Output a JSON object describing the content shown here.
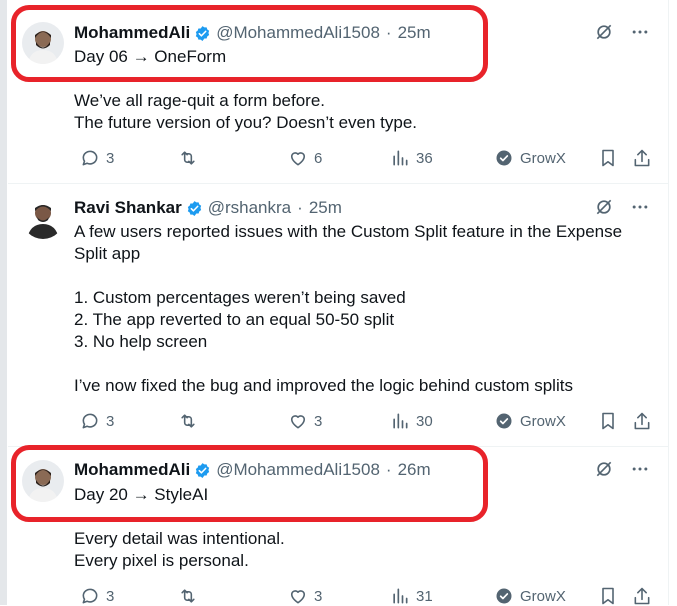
{
  "tweets": [
    {
      "author_name": "MohammedAli",
      "handle": "@MohammedAli1508",
      "time": "25m",
      "title_line": "Day 06 → OneForm",
      "body": "We’ve all rage-quit a form before.\nThe future version of you? Doesn’t even type.",
      "replies": "3",
      "retweets": "",
      "likes": "6",
      "views": "36",
      "growx": "GrowX"
    },
    {
      "author_name": "Ravi Shankar",
      "handle": "@rshankra",
      "time": "25m",
      "body": "A few users reported issues with the Custom Split feature in the Expense\nSplit app\n\n1. Custom percentages weren’t being saved\n2. The app reverted to an equal 50-50 split\n3. No help screen\n\nI’ve now fixed the bug and improved the logic behind custom splits",
      "replies": "3",
      "retweets": "",
      "likes": "3",
      "views": "30",
      "growx": "GrowX"
    },
    {
      "author_name": "MohammedAli",
      "handle": "@MohammedAli1508",
      "time": "26m",
      "title_line": "Day 20 → StyleAI",
      "body": "Every detail was intentional.\nEvery pixel is personal.",
      "replies": "3",
      "retweets": "",
      "likes": "3",
      "views": "31",
      "growx": "GrowX"
    }
  ],
  "colors": {
    "verified_blue": "#1d9bf0",
    "highlight_red": "#e8232a",
    "muted_text": "#536471"
  },
  "icons": [
    "verified-icon",
    "grok-icon",
    "more-icon",
    "reply-icon",
    "retweet-icon",
    "like-icon",
    "views-icon",
    "growx-check-icon",
    "bookmark-icon",
    "share-icon"
  ]
}
